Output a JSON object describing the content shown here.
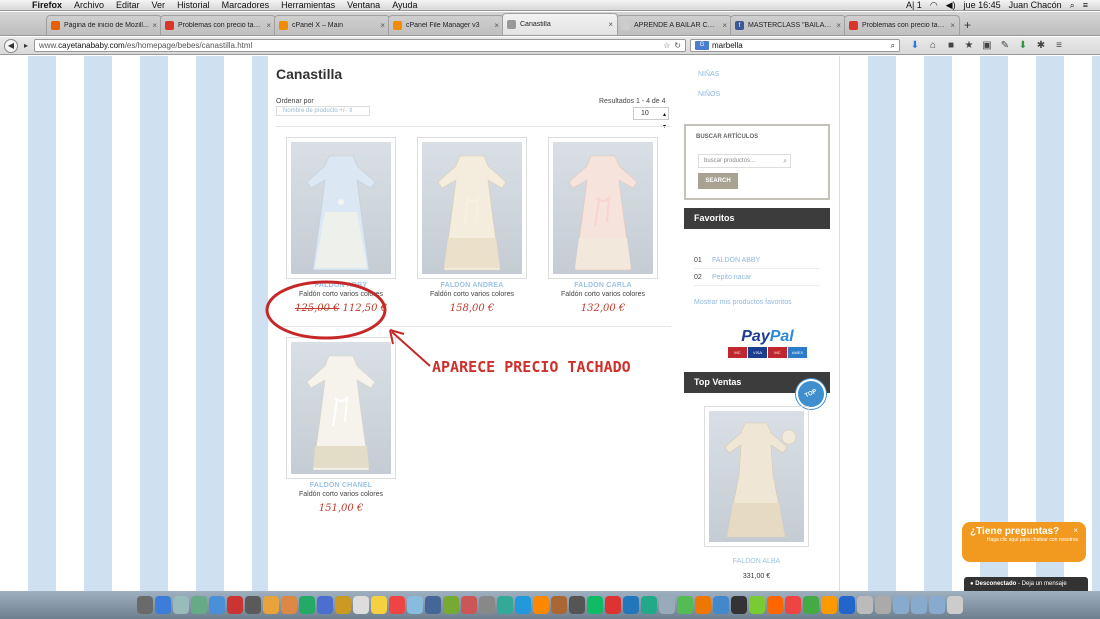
{
  "menubar": {
    "app": "Firefox",
    "items": [
      "Archivo",
      "Editar",
      "Ver",
      "Historial",
      "Marcadores",
      "Herramientas",
      "Ventana",
      "Ayuda"
    ],
    "clock": "jue 16:45",
    "user": "Juan Chacón",
    "indicator": "A| 1"
  },
  "tabs": [
    {
      "label": "Página de inicio de Mozill...",
      "color": "#e66000",
      "active": false
    },
    {
      "label": "Problemas con precio tach...",
      "color": "#d9362b",
      "active": false
    },
    {
      "label": "cPanel X – Main",
      "color": "#f08c00",
      "active": false
    },
    {
      "label": "cPanel File Manager v3",
      "color": "#f08c00",
      "active": false
    },
    {
      "label": "Canastilla",
      "color": "#999999",
      "active": true
    },
    {
      "label": "APRENDE A BAILAR CON ...",
      "color": "#cccccc",
      "active": false
    },
    {
      "label": "MASTERCLASS \"BAILANDO...",
      "color": "#3b5998",
      "active": false
    },
    {
      "label": "Problemas con precio tach...",
      "color": "#d9362b",
      "active": false
    }
  ],
  "navbar": {
    "url_prefix": "www.",
    "url_domain": "cayetanababy.com",
    "url_path": "/es/homepage/bebes/canastilla.html",
    "search_engine": "G",
    "search_value": "marbella"
  },
  "page": {
    "title": "Canastilla",
    "order_label": "Ordenar por",
    "order_value": "Nombre de producto +/-",
    "results": "Resultados 1 - 4 de 4",
    "limit": "10"
  },
  "products": [
    {
      "name": "FALDON ABBY",
      "desc": "Faldón corto varios colores",
      "old_price": "125,00 €",
      "price": "112,50 €",
      "tint": "#cfe0ef"
    },
    {
      "name": "FALDON ANDREA",
      "desc": "Faldón corto varios colores",
      "old_price": "",
      "price": "158,00 €",
      "tint": "#f3ead8"
    },
    {
      "name": "FALDON CARLA",
      "desc": "Faldón corto varios colores",
      "old_price": "",
      "price": "132,00 €",
      "tint": "#f2d8d4"
    },
    {
      "name": "FALDON CHANEL",
      "desc": "Faldón corto varios colores",
      "old_price": "",
      "price": "151,00 €",
      "tint": "#f1efe6"
    }
  ],
  "annotation": "APARECE PRECIO TACHADO",
  "sidebar": {
    "links": [
      "NIÑAS",
      "NIÑOS"
    ],
    "search_title": "BUSCAR ARTÍCULOS",
    "search_placeholder": "buscar productos...",
    "search_button": "SEARCH",
    "favorites_title": "Favoritos",
    "favorites": [
      {
        "n": "01",
        "label": "FALDON ABBY"
      },
      {
        "n": "02",
        "label": "Pepito nacar"
      }
    ],
    "favorites_show": "Mostrar mis productos favoritos",
    "paypal_a": "Pay",
    "paypal_b": "Pal",
    "cards": [
      "MC",
      "VISA",
      "MC",
      "AMEX"
    ],
    "top_title": "Top Ventas",
    "top_badge": "TOP",
    "top_product_name": "FALDON ALBA",
    "top_product_price": "331,00 €"
  },
  "chat": {
    "question": "¿Tiene preguntas?",
    "sub": "Haga clic aquí para chatear con nosotros",
    "close": "×",
    "status": "Desconectado",
    "status_msg": " - Deja un mensaje"
  },
  "dock_colors": [
    "#6a6a6a",
    "#3c7dd9",
    "#9bb",
    "#6a8",
    "#4a90d9",
    "#c33",
    "#5a5a5a",
    "#e8a33a",
    "#d84",
    "#2a6",
    "#4a6fd0",
    "#c92",
    "#ddd",
    "#f5d142",
    "#e44",
    "#8bd",
    "#469",
    "#7a3",
    "#c55",
    "#888",
    "#3a9",
    "#29d",
    "#f80",
    "#a63",
    "#555",
    "#1b6",
    "#d33",
    "#27b",
    "#2a8",
    "#9ab",
    "#5b5",
    "#e70",
    "#48c",
    "#333",
    "#7c3",
    "#f60",
    "#e44",
    "#4a4",
    "#f90",
    "#26c",
    "#bbb",
    "#aaa",
    "#8ac",
    "#8ac",
    "#8ac",
    "#ccc"
  ]
}
